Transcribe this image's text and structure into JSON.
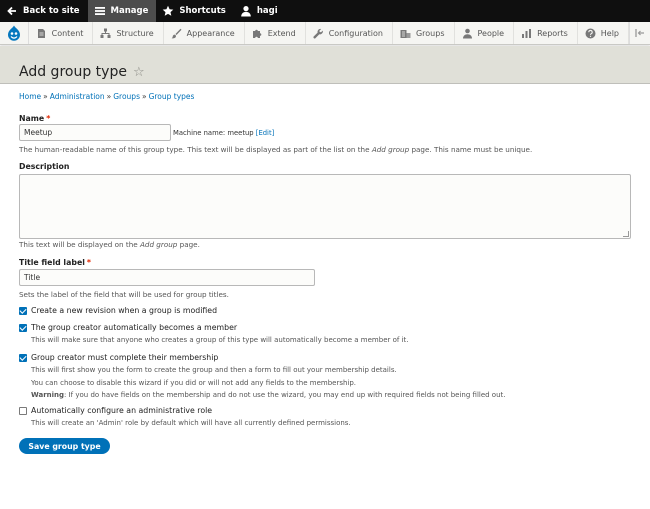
{
  "toolbar": {
    "back_label": "Back to site",
    "manage_label": "Manage",
    "shortcuts_label": "Shortcuts",
    "user_label": "hagi"
  },
  "tray": {
    "items": [
      {
        "label": "Content",
        "icon": "document-icon"
      },
      {
        "label": "Structure",
        "icon": "structure-icon"
      },
      {
        "label": "Appearance",
        "icon": "brush-icon"
      },
      {
        "label": "Extend",
        "icon": "puzzle-icon"
      },
      {
        "label": "Configuration",
        "icon": "wrench-icon"
      },
      {
        "label": "Groups",
        "icon": "groups-icon"
      },
      {
        "label": "People",
        "icon": "person-icon"
      },
      {
        "label": "Reports",
        "icon": "chart-icon"
      },
      {
        "label": "Help",
        "icon": "help-icon"
      }
    ]
  },
  "page": {
    "title": "Add group type",
    "breadcrumb": [
      "Home",
      "Administration",
      "Groups",
      "Group types"
    ]
  },
  "form": {
    "name_label": "Name",
    "name_value": "Meetup",
    "machine_name_prefix": "Machine name: meetup",
    "machine_name_edit": "[Edit]",
    "name_desc_1": "The human-readable name of this group type. This text will be displayed as part of the list on the ",
    "name_desc_em": "Add group",
    "name_desc_2": " page. This name must be unique.",
    "description_label": "Description",
    "description_value": "",
    "description_desc_1": "This text will be displayed on the ",
    "description_desc_em": "Add group",
    "description_desc_2": " page.",
    "title_label": "Title field label",
    "title_value": "Title",
    "title_desc": "Sets the label of the field that will be used for group titles.",
    "cb_revision": {
      "label": "Create a new revision when a group is modified",
      "checked": true
    },
    "cb_member": {
      "label": "The group creator automatically becomes a member",
      "checked": true,
      "desc": "This will make sure that anyone who creates a group of this type will automatically become a member of it."
    },
    "cb_wizard": {
      "label": "Group creator must complete their membership",
      "checked": true,
      "desc_1": "This will first show you the form to create the group and then a form to fill out your membership details.",
      "desc_2": "You can choose to disable this wizard if you did or will not add any fields to the membership.",
      "desc_warn": "Warning",
      "desc_3": ": If you do have fields on the membership and do not use the wizard, you may end up with required fields not being filled out."
    },
    "cb_admin": {
      "label": "Automatically configure an administrative role",
      "checked": false,
      "desc": "This will create an 'Admin' role by default which will have all currently defined permissions."
    },
    "submit_label": "Save group type"
  },
  "colors": {
    "accent": "#0071b8",
    "toolbar": "#0f0f0f",
    "header": "#e0e0d8",
    "required": "#e32700"
  }
}
